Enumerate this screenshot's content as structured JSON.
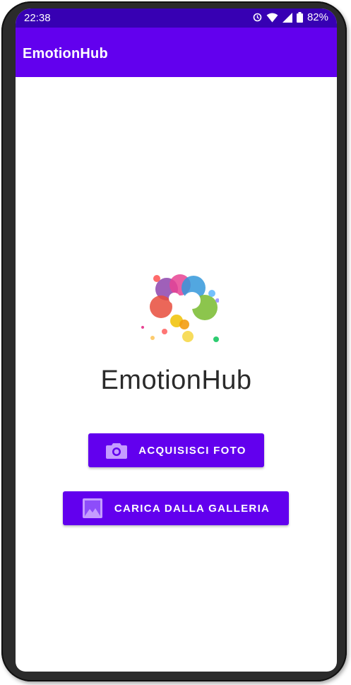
{
  "status_bar": {
    "time": "22:38",
    "battery": "82%",
    "icons": [
      "alarm-icon",
      "wifi-icon",
      "signal-icon",
      "battery-icon"
    ]
  },
  "app_bar": {
    "title": "EmotionHub"
  },
  "main": {
    "logo_icon": "emotionhub-logo-icon",
    "title": "EmotionHub",
    "buttons": [
      {
        "label": "ACQUISISCI FOTO",
        "icon": "camera-icon"
      },
      {
        "label": "CARICA DALLA GALLERIA",
        "icon": "image-icon"
      }
    ]
  },
  "colors": {
    "status_bar": "#3700b3",
    "primary": "#6200ee",
    "button_icon": "#c59cff",
    "title_text": "#2a2a2a"
  }
}
